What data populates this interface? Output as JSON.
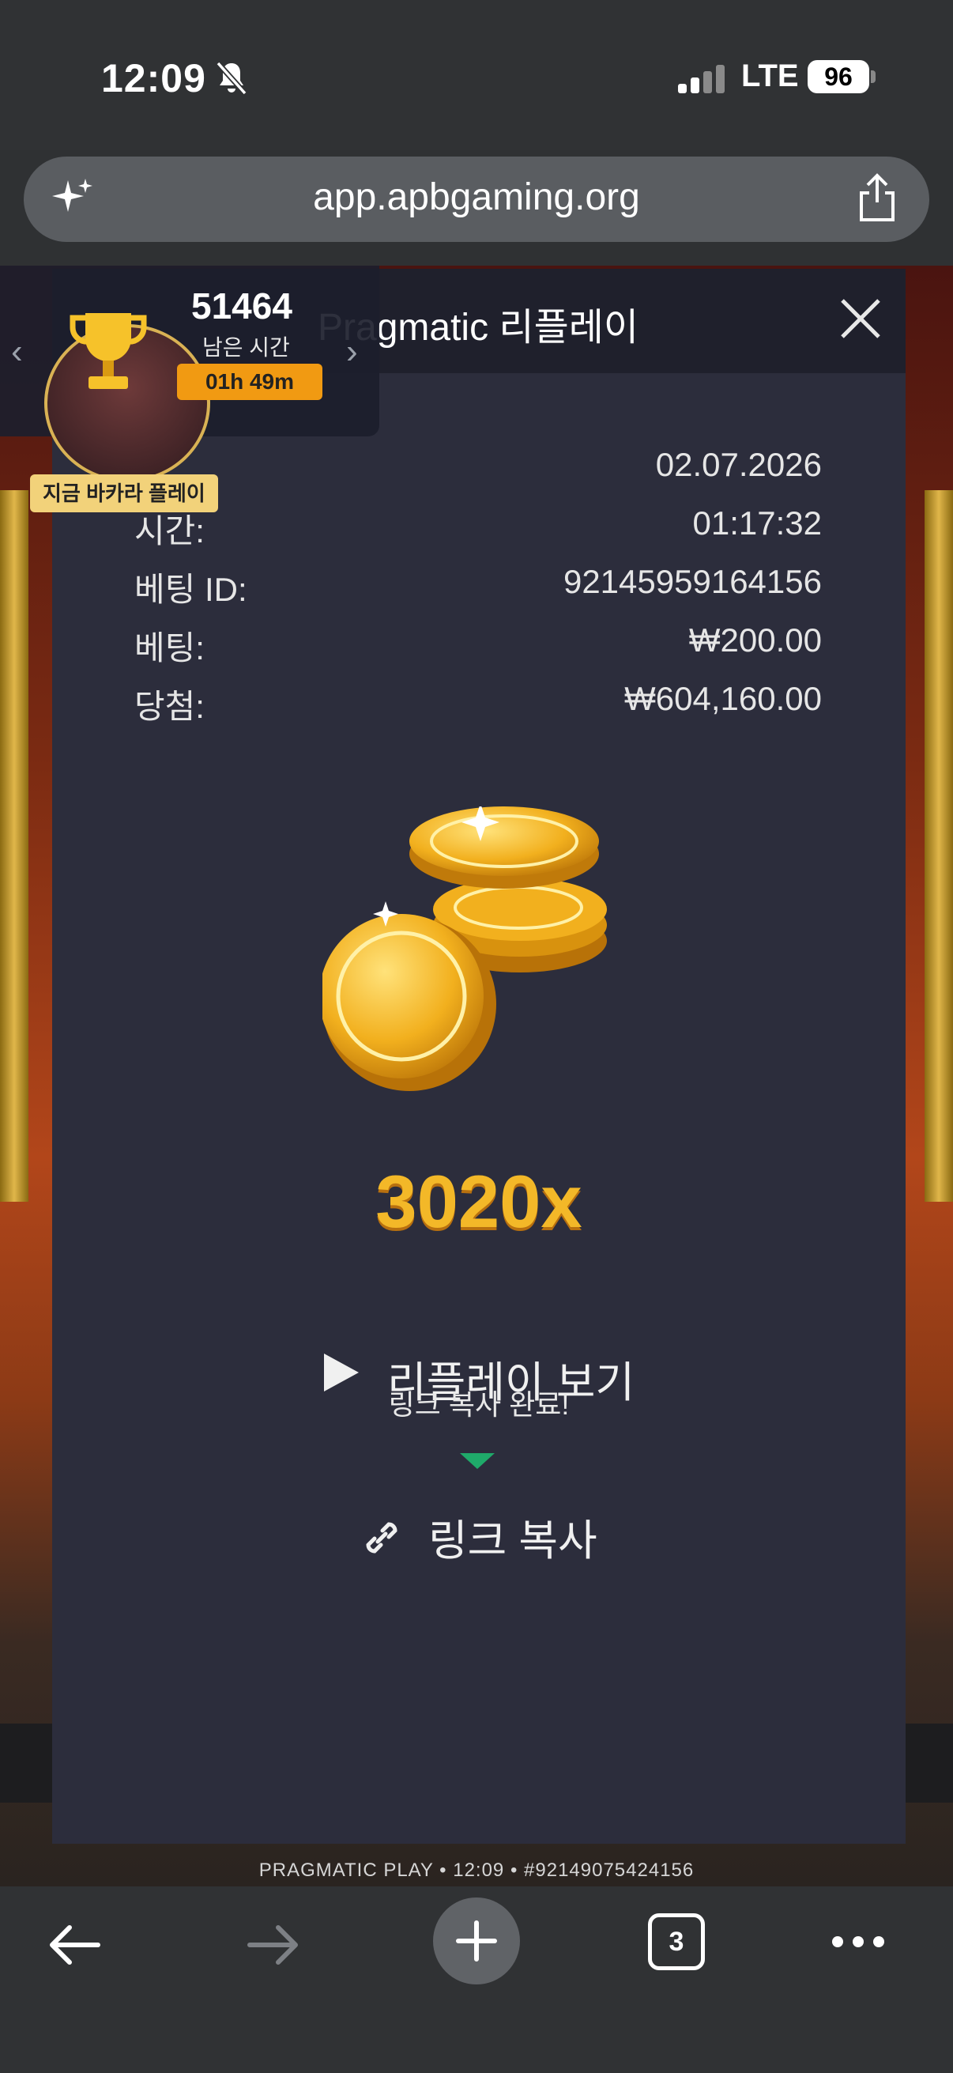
{
  "status_bar": {
    "time": "12:09",
    "network": "LTE",
    "battery": "96"
  },
  "browser": {
    "url": "app.apbgaming.org",
    "tab_count": "3"
  },
  "tournament": {
    "score": "51464",
    "remaining_label": "남은 시간",
    "timer": "01h 49m",
    "play_button": "지금 바카라 플레이"
  },
  "modal": {
    "title": "Pragmatic 리플레이",
    "rows": [
      {
        "label": "",
        "value": "02.07.2026"
      },
      {
        "label": "시간:",
        "value": "01:17:32"
      },
      {
        "label": "베팅 ID:",
        "value": "92145959164156"
      },
      {
        "label": "베팅:",
        "value": "₩200.00"
      },
      {
        "label": "당첨:",
        "value": "₩604,160.00"
      }
    ],
    "multiplier": "3020x",
    "replay_label": "리플레이 보기",
    "toast": "링크 복사 완료!",
    "copy_label": "링크 복사"
  },
  "game": {
    "provider_line": "PRAGMATIC PLAY • 12:09 • #92149075424156"
  },
  "colors": {
    "accent_gold": "#f3b828",
    "toast_green": "#1faa6a",
    "modal_bg": "#2c2d3c"
  }
}
